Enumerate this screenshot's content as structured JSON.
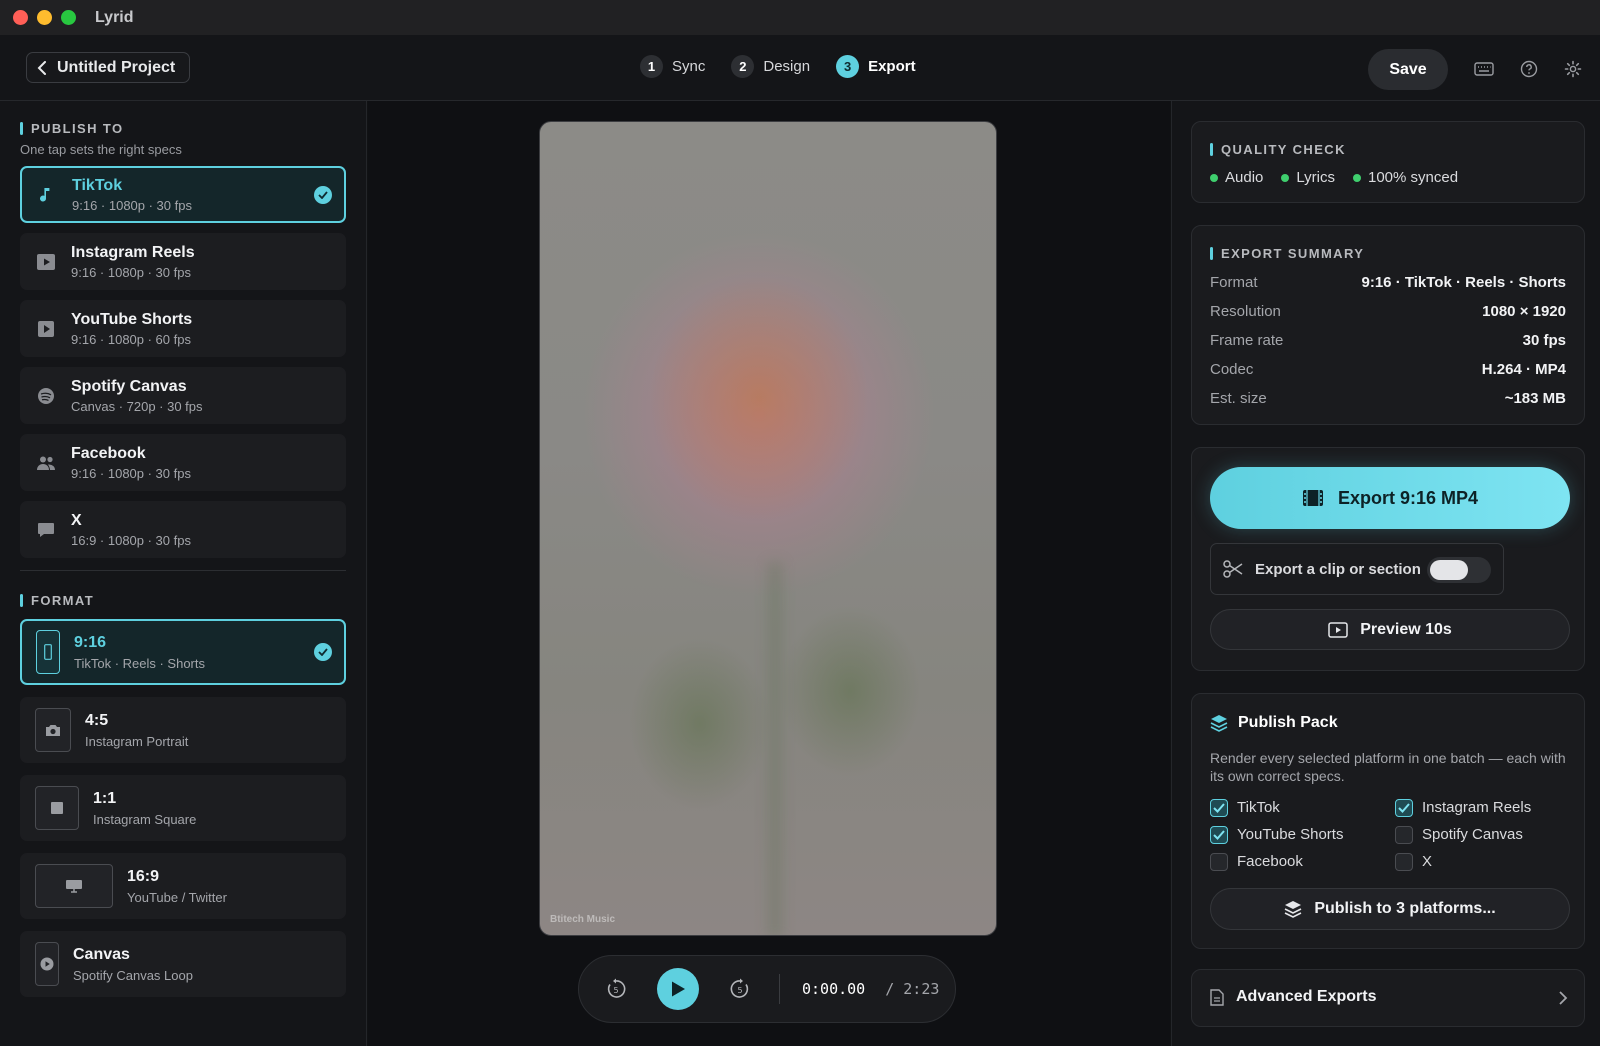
{
  "app": {
    "title": "Lyrid"
  },
  "header": {
    "back_label": "Untitled Project",
    "steps": [
      {
        "num": "1",
        "label": "Sync"
      },
      {
        "num": "2",
        "label": "Design"
      },
      {
        "num": "3",
        "label": "Export"
      }
    ],
    "active_step": "Export",
    "save_label": "Save"
  },
  "publish_to": {
    "title": "PUBLISH TO",
    "subtitle": "One tap sets the right specs",
    "items": [
      {
        "name": "TikTok",
        "spec": "9:16 · 1080p · 30 fps",
        "icon": "music-note-icon",
        "selected": true
      },
      {
        "name": "Instagram Reels",
        "spec": "9:16 · 1080p · 30 fps",
        "icon": "play-box-icon"
      },
      {
        "name": "YouTube Shorts",
        "spec": "9:16 · 1080p · 60 fps",
        "icon": "play-box-icon"
      },
      {
        "name": "Spotify Canvas",
        "spec": "Canvas · 720p · 30 fps",
        "icon": "disc-icon"
      },
      {
        "name": "Facebook",
        "spec": "9:16 · 1080p · 30 fps",
        "icon": "people-icon"
      },
      {
        "name": "X",
        "spec": "16:9 · 1080p · 30 fps",
        "icon": "chat-bubble-icon"
      }
    ]
  },
  "format": {
    "title": "FORMAT",
    "items": [
      {
        "name": "9:16",
        "desc": "TikTok · Reels · Shorts",
        "icon": "phone-icon",
        "selected": true
      },
      {
        "name": "4:5",
        "desc": "Instagram Portrait",
        "icon": "camera-icon"
      },
      {
        "name": "1:1",
        "desc": "Instagram Square",
        "icon": "square-icon"
      },
      {
        "name": "16:9",
        "desc": "YouTube / Twitter",
        "icon": "monitor-icon"
      },
      {
        "name": "Canvas",
        "desc": "Spotify Canvas Loop",
        "icon": "play-circle-icon"
      }
    ]
  },
  "preview": {
    "watermark": "Btitech Music"
  },
  "player": {
    "current": "0:00.00",
    "duration": "/ 2:23"
  },
  "quality_check": {
    "title": "QUALITY CHECK",
    "items": [
      "Audio",
      "Lyrics",
      "100% synced"
    ]
  },
  "export_summary": {
    "title": "EXPORT SUMMARY",
    "rows": [
      {
        "k": "Format",
        "v": "9:16 · TikTok · Reels · Shorts"
      },
      {
        "k": "Resolution",
        "v": "1080 × 1920"
      },
      {
        "k": "Frame rate",
        "v": "30 fps"
      },
      {
        "k": "Codec",
        "v": "H.264 · MP4"
      },
      {
        "k": "Est. size",
        "v": "~183 MB"
      }
    ]
  },
  "export": {
    "button_label": "Export 9:16 MP4",
    "clip_label": "Export a clip or section",
    "clip_enabled": false,
    "preview_label": "Preview 10s"
  },
  "publish_pack": {
    "title": "Publish Pack",
    "description": "Render every selected platform in one batch — each with its own correct specs.",
    "options": [
      {
        "label": "TikTok",
        "checked": true
      },
      {
        "label": "Instagram Reels",
        "checked": true
      },
      {
        "label": "YouTube Shorts",
        "checked": true
      },
      {
        "label": "Spotify Canvas",
        "checked": false
      },
      {
        "label": "Facebook",
        "checked": false
      },
      {
        "label": "X",
        "checked": false
      }
    ],
    "button_label": "Publish to 3 platforms..."
  },
  "advanced": {
    "label": "Advanced Exports"
  },
  "colors": {
    "accent": "#5ed0df",
    "ok": "#3fcf6e"
  }
}
